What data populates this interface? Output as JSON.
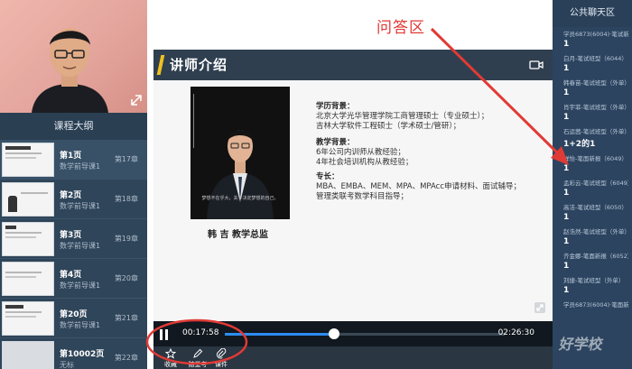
{
  "outline": {
    "header": "课程大纲",
    "items": [
      {
        "title": "第1页",
        "subtitle": "数学前导课1",
        "chapter": "第17章"
      },
      {
        "title": "第2页",
        "subtitle": "数学前导课1",
        "chapter": "第18章"
      },
      {
        "title": "第3页",
        "subtitle": "数学前导课1",
        "chapter": "第19章"
      },
      {
        "title": "第4页",
        "subtitle": "数学前导课1",
        "chapter": "第20章"
      },
      {
        "title": "第20页",
        "subtitle": "数学前导课1",
        "chapter": "第21章"
      },
      {
        "title": "第10002页",
        "subtitle": "无标",
        "chapter": "第22章"
      }
    ]
  },
  "slide": {
    "title": "讲师介绍",
    "name_line": "韩 吉   教学总监",
    "portrait_quote": "梦想不在乎大，关乎决定梦想的自己。",
    "education_label": "学历背景：",
    "education": [
      "北京大学光华管理学院工商管理硕士（专业硕士）；",
      "吉林大学软件工程硕士（学术硕士/管研）；"
    ],
    "teaching_label": "教学背景：",
    "teaching": [
      "6年公司内训师从教经验；",
      "4年社会培训机构从教经验；"
    ],
    "specialty_label": "专长：",
    "specialty": [
      "MBA、EMBA、MEM、MPA、MPAcc申请材料、面试辅导；",
      "管理类联考数学科目指导；"
    ]
  },
  "player": {
    "current_time": "00:17:58",
    "total_time": "02:26:30",
    "progress": 0.39,
    "tools": [
      {
        "icon": "star-icon",
        "label": "收藏"
      },
      {
        "icon": "pencil-icon",
        "label": "随堂考"
      },
      {
        "icon": "paperclip-icon",
        "label": "课件"
      }
    ]
  },
  "annotation": {
    "label": "问答区",
    "color": "#e03a35"
  },
  "chat": {
    "header": "公共聊天区",
    "messages": [
      {
        "user": "学员6873(6004)·笔试新报",
        "text": "1"
      },
      {
        "user": "白月-笔试班型（6044）",
        "text": "1"
      },
      {
        "user": "韩春苗-笔试班型（外单）",
        "text": "1"
      },
      {
        "user": "肖宇菲-笔试班型（外单）",
        "text": "1"
      },
      {
        "user": "石运茜-笔试班型（外单）",
        "text": "1+2的1"
      },
      {
        "user": "祥怡-笔面新报（6049）",
        "text": "1"
      },
      {
        "user": "孟彩云-笔试班型（6049）",
        "text": "1"
      },
      {
        "user": "高洁-笔试班型（6050）",
        "text": "1"
      },
      {
        "user": "赵浩然-笔试班型（外单）",
        "text": "1"
      },
      {
        "user": "齐金娜-笔面新报（6052）",
        "text": "1"
      },
      {
        "user": "刘捷-笔试班型（外单）",
        "text": "1"
      },
      {
        "user": "学员6873(6004)·笔面新报",
        "text": ""
      }
    ]
  },
  "watermark": "好学校",
  "colors": {
    "sidebar": "#2c4257",
    "chat": "#2c4460",
    "accent": "#2d8cf0",
    "annotation": "#e03a35"
  }
}
